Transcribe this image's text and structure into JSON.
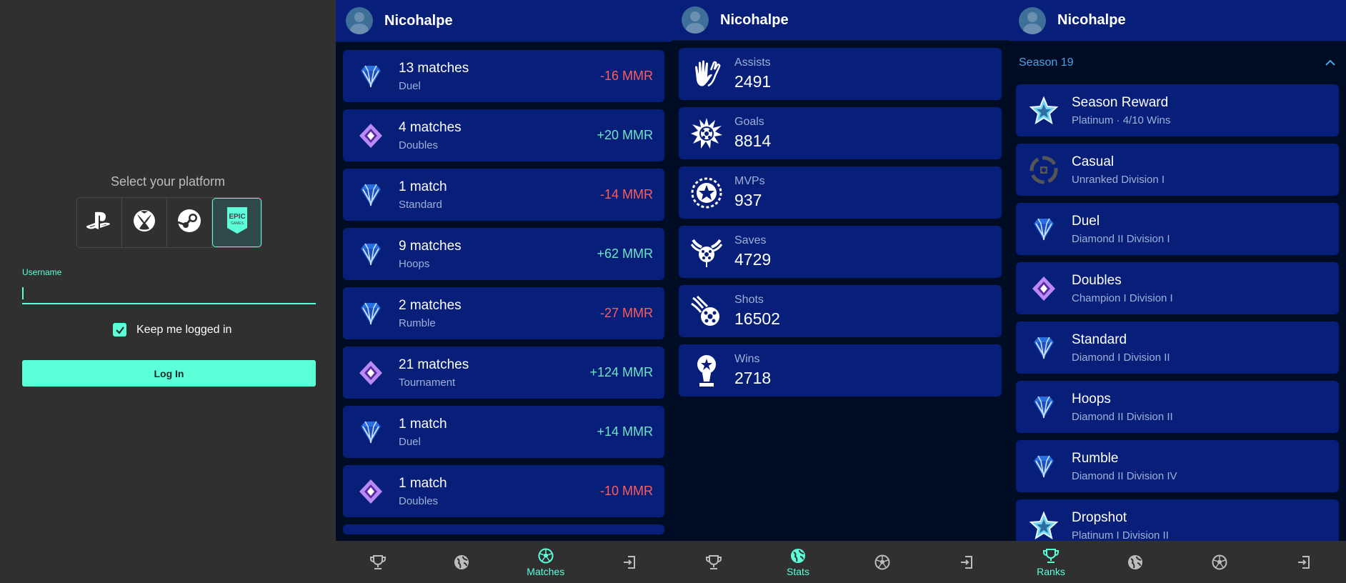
{
  "login": {
    "title": "Select your platform",
    "platforms": [
      "PlayStation",
      "Xbox",
      "Steam",
      "Epic Games"
    ],
    "selected_platform": "Epic Games",
    "epic_text": "EPIC",
    "epic_sub": "GAMES",
    "username_label": "Username",
    "username_value": "",
    "keep_logged_in_label": "Keep me logged in",
    "keep_logged_in": true,
    "login_button": "Log In"
  },
  "user": {
    "name": "Nicohalpe"
  },
  "matches": [
    {
      "title": "13 matches",
      "mode": "Duel",
      "mmr": "-16 MMR",
      "tier": "diamond",
      "positive": false
    },
    {
      "title": "4 matches",
      "mode": "Doubles",
      "mmr": "+20 MMR",
      "tier": "champion",
      "positive": true
    },
    {
      "title": "1 match",
      "mode": "Standard",
      "mmr": "-14 MMR",
      "tier": "diamond",
      "positive": false
    },
    {
      "title": "9 matches",
      "mode": "Hoops",
      "mmr": "+62 MMR",
      "tier": "diamond",
      "positive": true
    },
    {
      "title": "2 matches",
      "mode": "Rumble",
      "mmr": "-27 MMR",
      "tier": "diamond",
      "positive": false
    },
    {
      "title": "21 matches",
      "mode": "Tournament",
      "mmr": "+124 MMR",
      "tier": "champion",
      "positive": true
    },
    {
      "title": "1 match",
      "mode": "Duel",
      "mmr": "+14 MMR",
      "tier": "diamond",
      "positive": true
    },
    {
      "title": "1 match",
      "mode": "Doubles",
      "mmr": "-10 MMR",
      "tier": "champion",
      "positive": false
    }
  ],
  "stats": [
    {
      "label": "Assists",
      "value": "2491",
      "icon": "assist-hands-icon"
    },
    {
      "label": "Goals",
      "value": "8814",
      "icon": "goal-burst-icon"
    },
    {
      "label": "MVPs",
      "value": "937",
      "icon": "mvp-star-icon"
    },
    {
      "label": "Saves",
      "value": "4729",
      "icon": "save-wings-icon"
    },
    {
      "label": "Shots",
      "value": "16502",
      "icon": "shot-fireball-icon"
    },
    {
      "label": "Wins",
      "value": "2718",
      "icon": "win-trophy-icon"
    }
  ],
  "ranks": {
    "season": "Season 19",
    "items": [
      {
        "playlist": "Season Reward",
        "rank": "Platinum · 4/10 Wins",
        "tier": "star"
      },
      {
        "playlist": "Casual",
        "rank": "Unranked Division I",
        "tier": "unranked"
      },
      {
        "playlist": "Duel",
        "rank": "Diamond II Division I",
        "tier": "diamond"
      },
      {
        "playlist": "Doubles",
        "rank": "Champion I Division I",
        "tier": "champion"
      },
      {
        "playlist": "Standard",
        "rank": "Diamond I Division II",
        "tier": "diamond"
      },
      {
        "playlist": "Hoops",
        "rank": "Diamond II Division II",
        "tier": "diamond"
      },
      {
        "playlist": "Rumble",
        "rank": "Diamond II Division IV",
        "tier": "diamond"
      },
      {
        "playlist": "Dropshot",
        "rank": "Platinum I Division II",
        "tier": "star"
      }
    ]
  },
  "nav": {
    "matches_label": "Matches",
    "stats_label": "Stats",
    "ranks_label": "Ranks"
  },
  "colors": {
    "accent": "#5dffd9",
    "card": "#081f7a",
    "negative": "#ff5c5c",
    "positive": "#6fe3c4",
    "season": "#4aa3e8"
  }
}
